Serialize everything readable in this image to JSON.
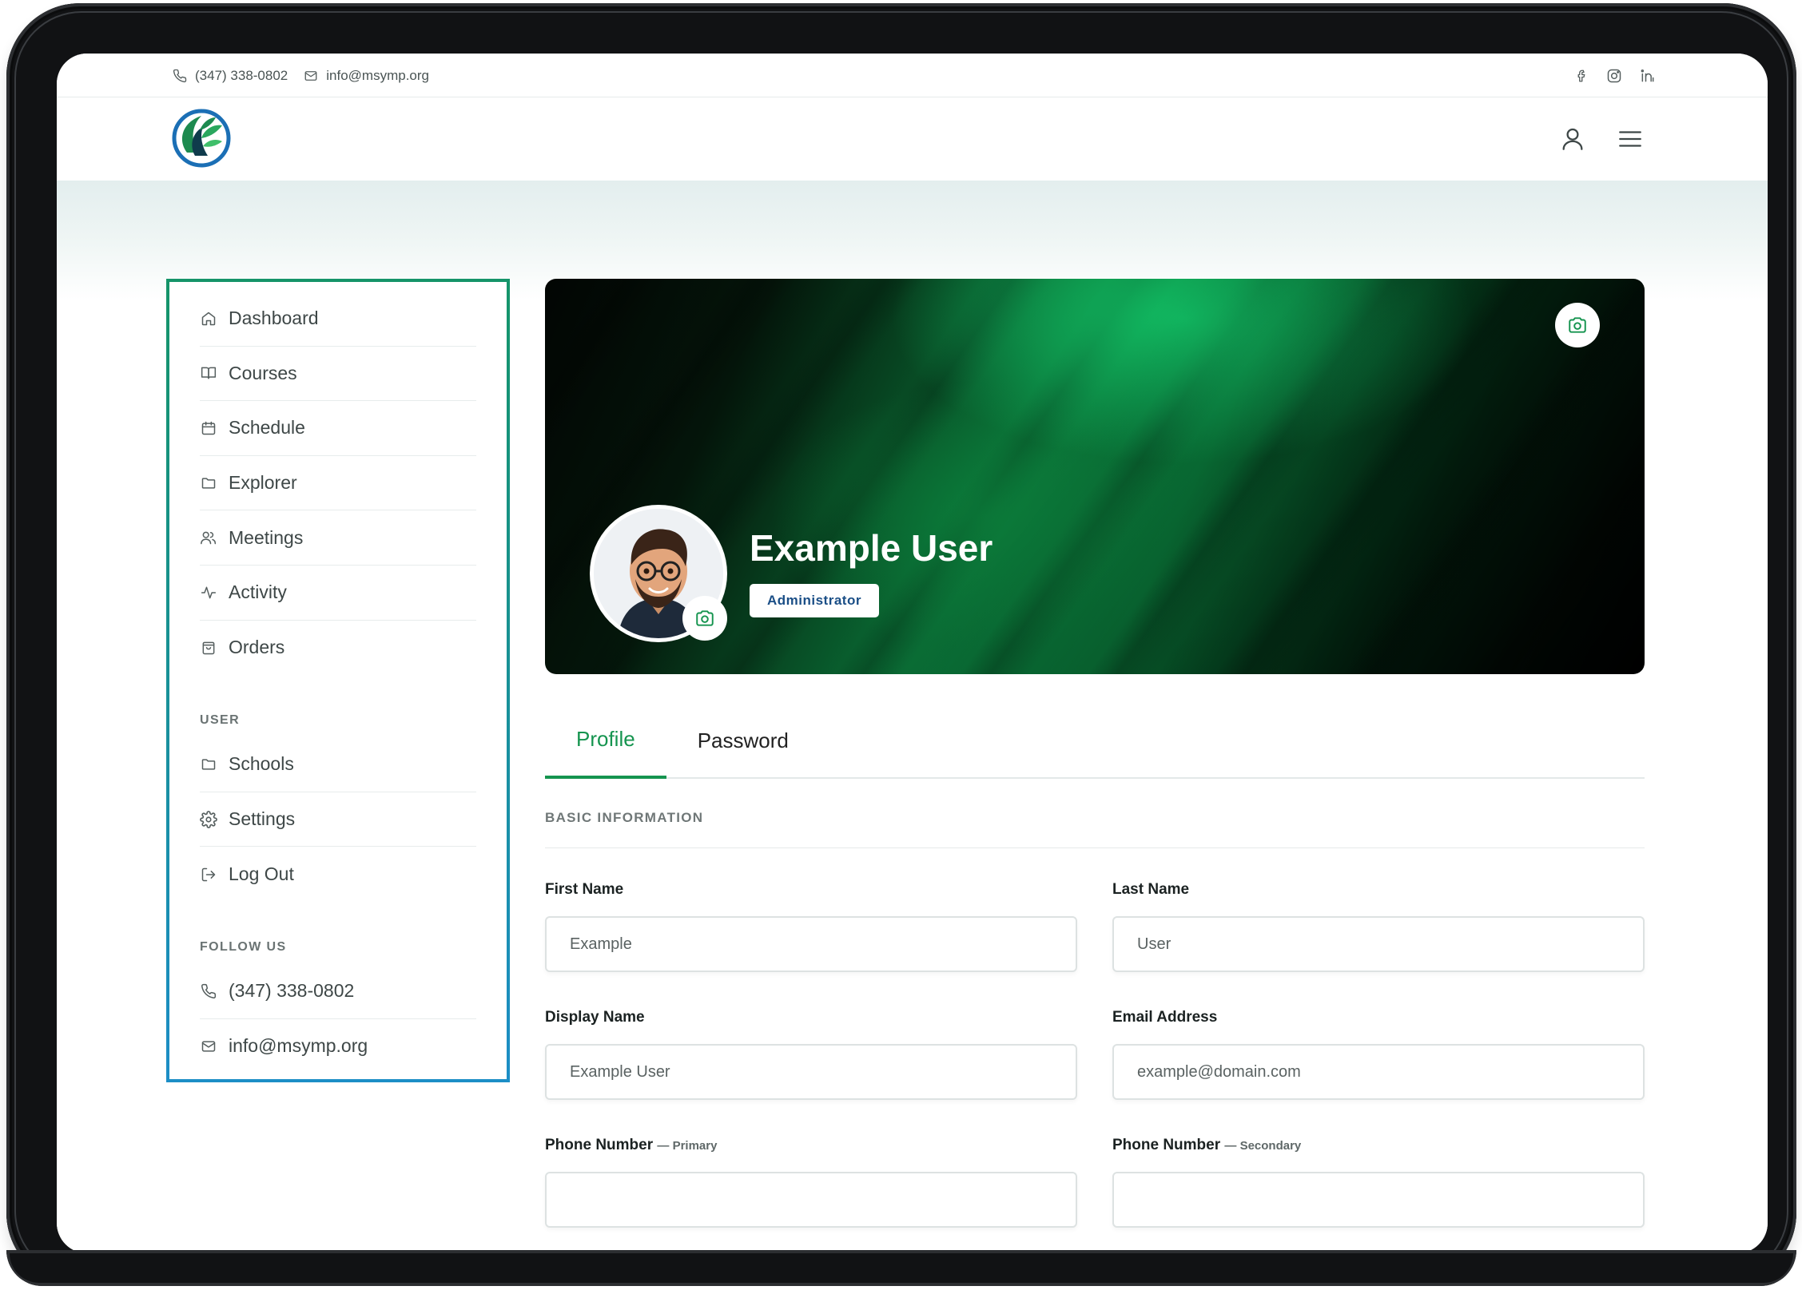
{
  "topbar": {
    "phone": "(347) 338-0802",
    "email": "info@msymp.org",
    "social_icons": [
      "facebook-icon",
      "instagram-icon",
      "linkedin-icon"
    ]
  },
  "header": {
    "icons": [
      "user-icon",
      "hamburger-menu-icon"
    ]
  },
  "sidebar": {
    "main_items": [
      {
        "label": "Dashboard",
        "icon": "home-icon"
      },
      {
        "label": "Courses",
        "icon": "book-icon"
      },
      {
        "label": "Schedule",
        "icon": "calendar-icon"
      },
      {
        "label": "Explorer",
        "icon": "folder-icon"
      },
      {
        "label": "Meetings",
        "icon": "users-icon"
      },
      {
        "label": "Activity",
        "icon": "activity-icon"
      },
      {
        "label": "Orders",
        "icon": "shopping-bag-icon"
      }
    ],
    "user_section_label": "USER",
    "user_items": [
      {
        "label": "Schools",
        "icon": "folder-icon"
      },
      {
        "label": "Settings",
        "icon": "gear-icon"
      },
      {
        "label": "Log Out",
        "icon": "logout-icon"
      }
    ],
    "follow_section_label": "FOLLOW US",
    "follow_items": [
      {
        "label": "(347) 338-0802",
        "icon": "phone-icon"
      },
      {
        "label": "info@msymp.org",
        "icon": "mail-icon"
      }
    ]
  },
  "profile": {
    "name": "Example User",
    "role": "Administrator"
  },
  "tabs": [
    {
      "label": "Profile",
      "active": true
    },
    {
      "label": "Password",
      "active": false
    }
  ],
  "form": {
    "section_title": "BASIC INFORMATION",
    "first_name": {
      "label": "First Name",
      "placeholder": "Example"
    },
    "last_name": {
      "label": "Last Name",
      "placeholder": "User"
    },
    "display_name": {
      "label": "Display Name",
      "placeholder": "Example User"
    },
    "email": {
      "label": "Email Address",
      "placeholder": "example@domain.com"
    },
    "phone_primary": {
      "label": "Phone Number",
      "sub": "— Primary",
      "placeholder": ""
    },
    "phone_secondary": {
      "label": "Phone Number",
      "sub": "— Secondary",
      "placeholder": ""
    }
  },
  "colors": {
    "accent": "#15944f",
    "sidebar_border_top": "#159469",
    "sidebar_border_bottom": "#1c8ec6",
    "role_text": "#1a4e86"
  }
}
